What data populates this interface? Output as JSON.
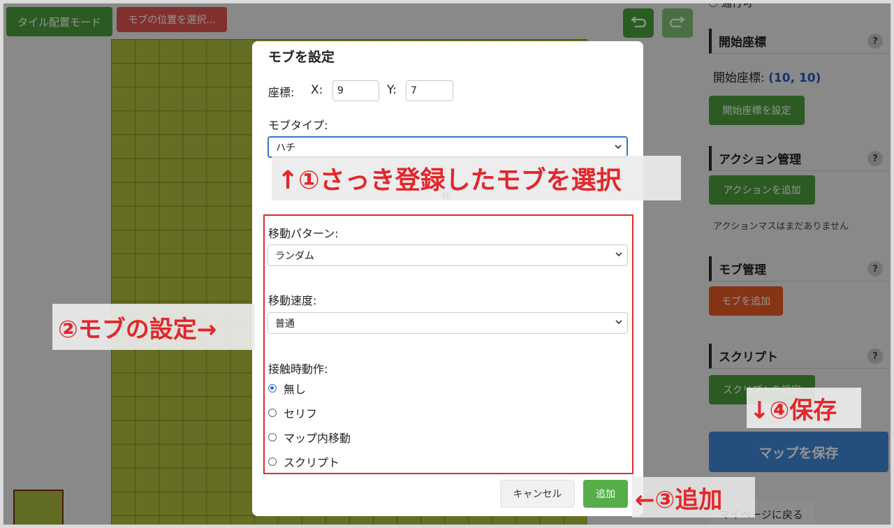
{
  "toolbar": {
    "tile_mode": "タイル配置モード",
    "select_mob_pos": "モブの位置を選択..."
  },
  "sidebar": {
    "top_radio_partial": "通行可",
    "start_coord": {
      "title": "開始座標",
      "help": "?",
      "label": "開始座標:",
      "value": "(10, 10)",
      "button": "開始座標を設定"
    },
    "actions": {
      "title": "アクション管理",
      "help": "?",
      "button": "アクションを追加",
      "note": "アクションマスはまだありません"
    },
    "mobs": {
      "title": "モブ管理",
      "help": "?",
      "button": "モブを追加"
    },
    "script": {
      "title": "スクリプト",
      "help": "?",
      "button": "スクリプトを設定"
    },
    "save_map": "マップを保存",
    "back_mypage": "マイページに戻る"
  },
  "modal": {
    "title": "モブを設定",
    "coord_label": "座標:",
    "x_label": "X:",
    "x_value": "9",
    "y_label": "Y:",
    "y_value": "7",
    "mob_type_label": "モブタイプ:",
    "mob_type_value": "ハチ",
    "move_pattern_label": "移動パターン:",
    "move_pattern_value": "ランダム",
    "move_speed_label": "移動速度:",
    "move_speed_value": "普通",
    "contact_label": "接触時動作:",
    "contact_options": [
      "無し",
      "セリフ",
      "マップ内移動",
      "スクリプト"
    ],
    "contact_selected": "無し",
    "cancel": "キャンセル",
    "add": "追加"
  },
  "annotations": {
    "a1": "↑①さっき登録したモブを選択",
    "a2": "②モブの設定→",
    "a3": "←③追加",
    "a4": "↓④保存"
  },
  "colors": {
    "annotation_red": "#e4262b",
    "green_button": "#4a9e3c",
    "save_blue": "#3f88d8",
    "mob_orange": "#e55a24"
  }
}
